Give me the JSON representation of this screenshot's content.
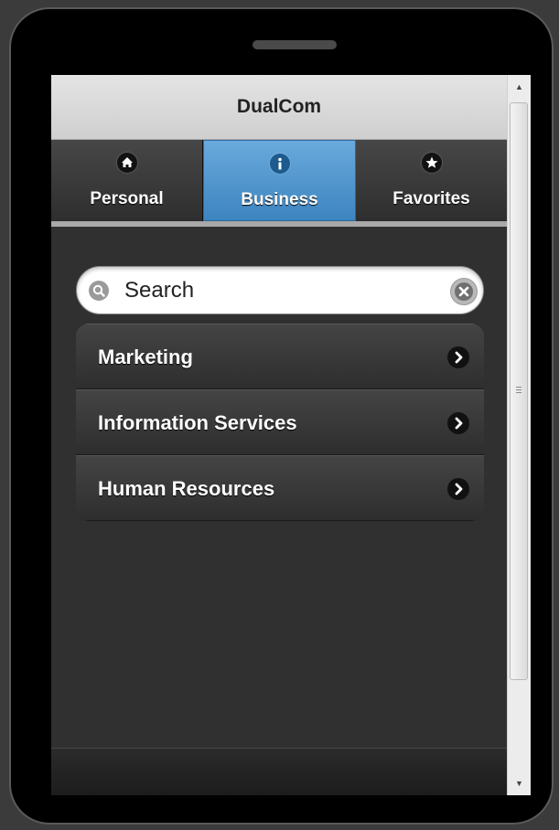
{
  "app": {
    "title": "DualCom"
  },
  "tabs": [
    {
      "label": "Personal",
      "icon": "home-icon",
      "active": false
    },
    {
      "label": "Business",
      "icon": "info-icon",
      "active": true
    },
    {
      "label": "Favorites",
      "icon": "star-icon",
      "active": false
    }
  ],
  "search": {
    "placeholder": "Search",
    "value": ""
  },
  "list": {
    "items": [
      {
        "label": "Marketing",
        "icon": "chevron-right-icon"
      },
      {
        "label": "Information Services",
        "icon": "chevron-right-icon"
      },
      {
        "label": "Human Resources",
        "icon": "chevron-right-icon"
      }
    ]
  },
  "colors": {
    "accent": "#4a90c8",
    "background": "#303030",
    "header": "#d6d6d6"
  }
}
